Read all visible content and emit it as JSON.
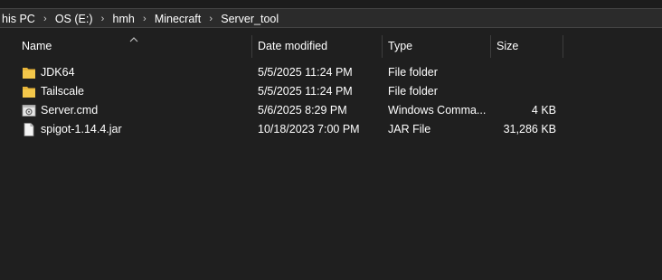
{
  "breadcrumb": {
    "items": [
      "his PC",
      "OS (E:)",
      "hmh",
      "Minecraft",
      "Server_tool"
    ],
    "separator": "›"
  },
  "columns": {
    "name": "Name",
    "date": "Date modified",
    "type": "Type",
    "size": "Size"
  },
  "files": [
    {
      "name": "JDK64",
      "date": "5/5/2025 11:24 PM",
      "type": "File folder",
      "size": "",
      "icon": "folder-icon"
    },
    {
      "name": "Tailscale",
      "date": "5/5/2025 11:24 PM",
      "type": "File folder",
      "size": "",
      "icon": "folder-icon"
    },
    {
      "name": "Server.cmd",
      "date": "5/6/2025 8:29 PM",
      "type": "Windows Comma...",
      "size": "4 KB",
      "icon": "cmd-file-icon"
    },
    {
      "name": "spigot-1.14.4.jar",
      "date": "10/18/2023 7:00 PM",
      "type": "JAR File",
      "size": "31,286 KB",
      "icon": "file-icon"
    }
  ],
  "colors": {
    "background": "#1f1f1f",
    "folder": "#f3c74a",
    "text": "#ffffff"
  }
}
